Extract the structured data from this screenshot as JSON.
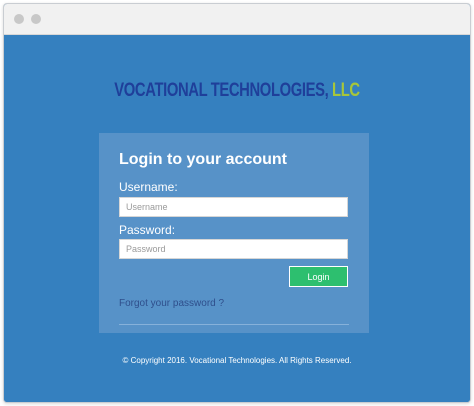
{
  "brand": {
    "name": "VOCATIONAL TECHNOLOGIES,",
    "suffix": " LLC",
    "colors": {
      "name": "#1f3f9a",
      "suffix": "#a7c63a"
    }
  },
  "login": {
    "title": "Login to your account",
    "username_label": "Username:",
    "username_placeholder": "Username",
    "password_label": "Password:",
    "password_placeholder": "Password",
    "login_button": "Login",
    "forgot_link": "Forgot your password ?"
  },
  "footer": {
    "copyright": "© Copyright 2016. Vocational Technologies. All Rights Reserved."
  },
  "colors": {
    "background": "#3580bf",
    "panel": "#5792c8",
    "button": "#2dbf6f"
  }
}
